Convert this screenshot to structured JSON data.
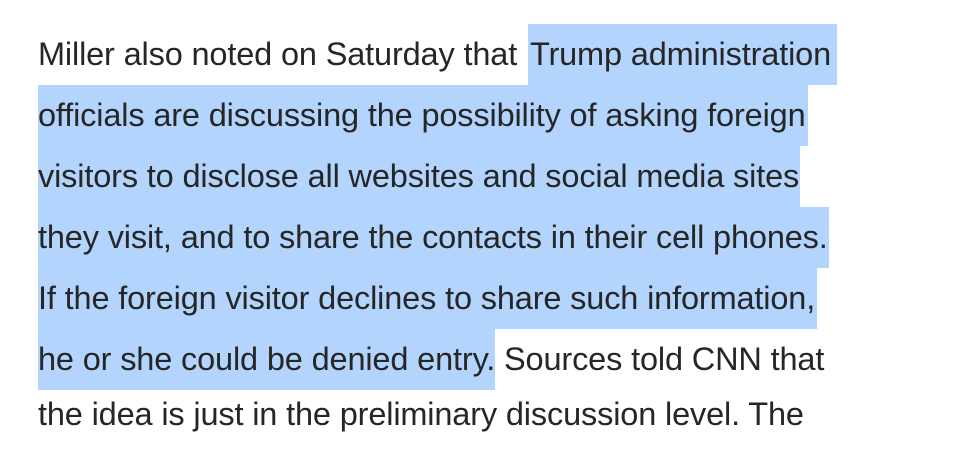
{
  "article": {
    "lines": [
      {
        "plain": "Miller also noted on Saturday that ",
        "highlighted": "Trump administration",
        "after": ""
      },
      {
        "plain": "",
        "highlighted": "officials are discussing the possibility of asking foreign",
        "after": ""
      },
      {
        "plain": "",
        "highlighted": "visitors to disclose all websites and social media sites",
        "after": ""
      },
      {
        "plain": "",
        "highlighted": "they visit, and to share the contacts in their cell phones.",
        "after": ""
      },
      {
        "plain": "",
        "highlighted": "If the foreign visitor declines to share such information,",
        "after": ""
      },
      {
        "plain": "",
        "highlighted": "he or she could be denied entry.",
        "after": " Sources told CNN that"
      },
      {
        "plain": "the idea is just in the preliminary discussion level. The",
        "highlighted": "",
        "after": ""
      }
    ]
  },
  "colors": {
    "text": "#262626",
    "selection": "#b3d4fc",
    "background": "#ffffff"
  }
}
